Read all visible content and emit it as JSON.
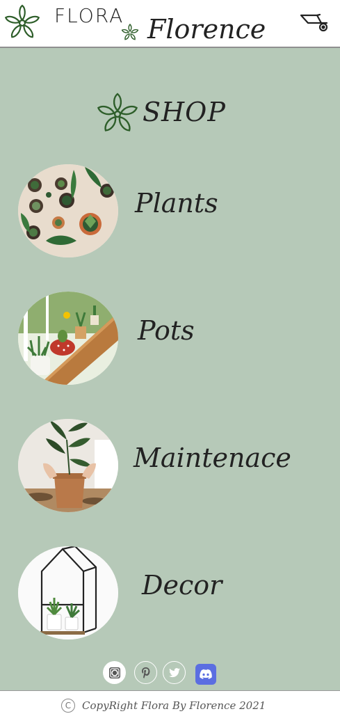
{
  "header": {
    "brand_top": "FLORA",
    "brand_bottom": "Florence",
    "logo_icon": "flower-logo-icon",
    "cart_icon": "wheelbarrow-cart-icon"
  },
  "shop": {
    "title": "SHOP",
    "icon": "flower-icon"
  },
  "categories": [
    {
      "label": "Plants",
      "image": "potted-succulents-photo"
    },
    {
      "label": "Pots",
      "image": "windowsill-pots-photo"
    },
    {
      "label": "Maintenace",
      "image": "repotting-plant-photo"
    },
    {
      "label": "Decor",
      "image": "terrarium-house-photo"
    }
  ],
  "social": [
    "instagram-icon",
    "pinterest-icon",
    "twitter-icon",
    "discord-icon"
  ],
  "footer": {
    "copyright_symbol": "C",
    "text": "CopyRight Flora By Florence 2021"
  },
  "colors": {
    "background": "#b6c9b8",
    "header_bg": "#ffffff",
    "leaf_green": "#2e5e2a",
    "discord": "#5b6ee1"
  }
}
